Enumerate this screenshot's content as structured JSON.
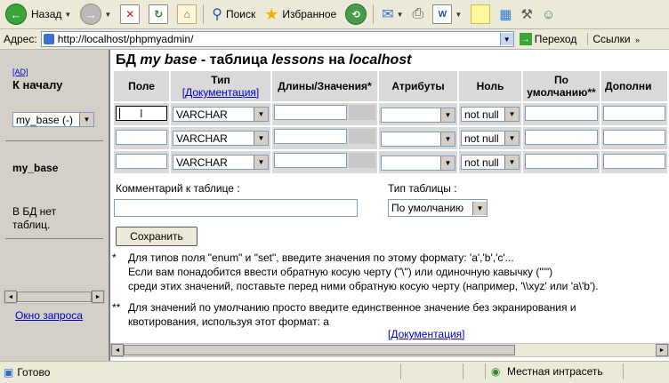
{
  "toolbar": {
    "back_label": "Назад",
    "search_label": "Поиск",
    "favorites_label": "Избранное"
  },
  "address": {
    "label": "Адрес:",
    "url": "http://localhost/phpmyadmin/",
    "go_label": "Переход",
    "links_label": "Ссылки"
  },
  "sidebar": {
    "ad_link": "[AD]",
    "home_link": "К началу",
    "db_select": "my_base (-)",
    "db_name": "my_base",
    "no_tables": "В БД нет таблиц.",
    "query_window": "Окно запроса"
  },
  "main": {
    "heading_prefix": "БД ",
    "heading_db": "my  base",
    "heading_mid": " - таблица ",
    "heading_table": "lessons",
    "heading_on": " на ",
    "heading_host": "localhost",
    "columns": {
      "field": "Поле",
      "type": "Тип",
      "type_doc": "[Документация]",
      "length": "Длины/Значения*",
      "attributes": "Атрибуты",
      "null": "Ноль",
      "default_1": "По",
      "default_2": "умолчанию**",
      "extra": "Дополни"
    },
    "rows": [
      {
        "type": "VARCHAR",
        "null": "not null"
      },
      {
        "type": "VARCHAR",
        "null": "not null"
      },
      {
        "type": "VARCHAR",
        "null": "not null"
      }
    ],
    "comment_label": "Комментарий к таблице :",
    "table_type_label": "Тип таблицы :",
    "table_type_value": "По умолчанию",
    "save_button": "Сохранить",
    "note1_line1": "Для типов поля \"enum\" и \"set\", введите значения по этому формату: 'a','b','c'...",
    "note1_line2": "Если вам понадобится ввести обратную косую черту (\"\\\") или одиночную кавычку (\"'\")",
    "note1_line3": "среди этих значений,   поставьте перед ними обратную косую черту (например, '\\\\xyz' или 'a\\'b').",
    "note2_line1": "Для значений по умолчанию просто введите единственное значение без экранирования и",
    "note2_line2": "квотирования,  используя этот формат: a",
    "doc_link": "[Документация]"
  },
  "status": {
    "done": "Готово",
    "zone": "Местная интрасеть"
  }
}
